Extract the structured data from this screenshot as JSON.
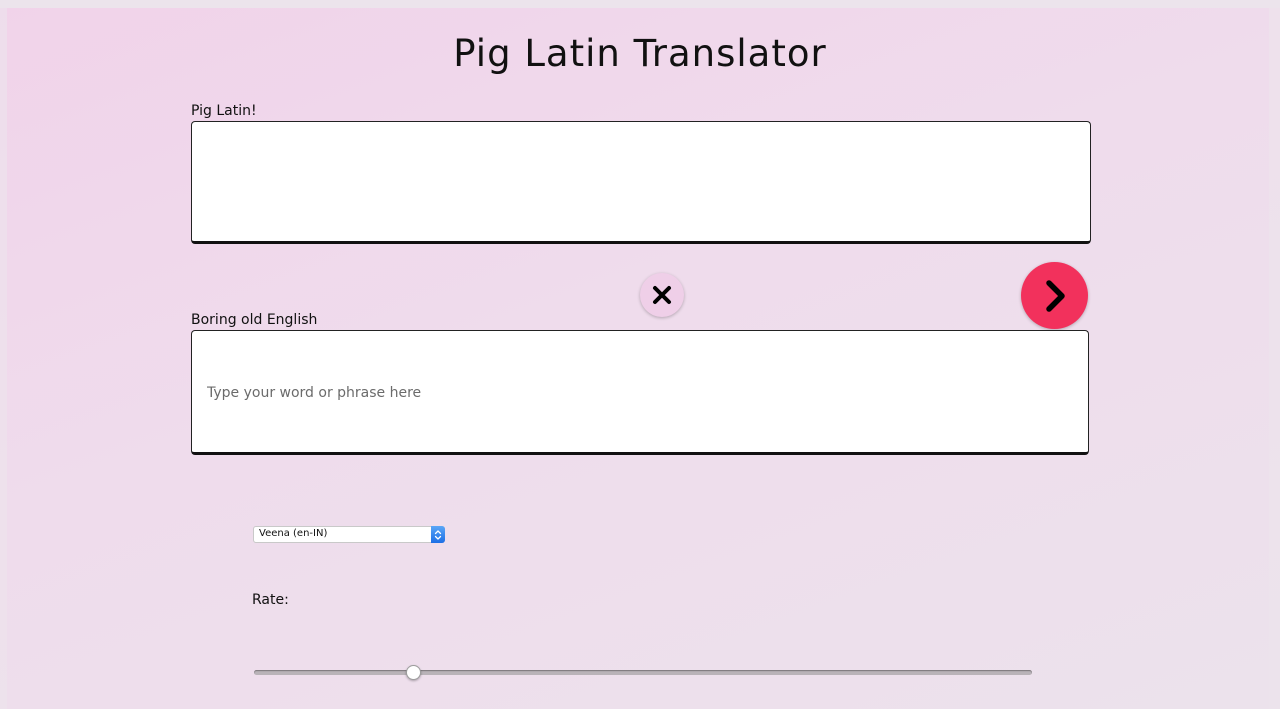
{
  "page": {
    "title": "Pig Latin Translator"
  },
  "pig_latin": {
    "label": "Pig Latin!",
    "value": ""
  },
  "english": {
    "label": "Boring old English",
    "value": "",
    "placeholder": "Type your word or phrase here"
  },
  "buttons": {
    "clear_icon": "close-icon",
    "translate_icon": "chevron-right-icon"
  },
  "voice": {
    "selected": "Veena (en-IN)"
  },
  "rate": {
    "label": "Rate:",
    "value_fraction": 0.205
  },
  "colors": {
    "translate_button": "#f2315c",
    "clear_button": "#efcfe8",
    "background": "#f1d3ea"
  }
}
